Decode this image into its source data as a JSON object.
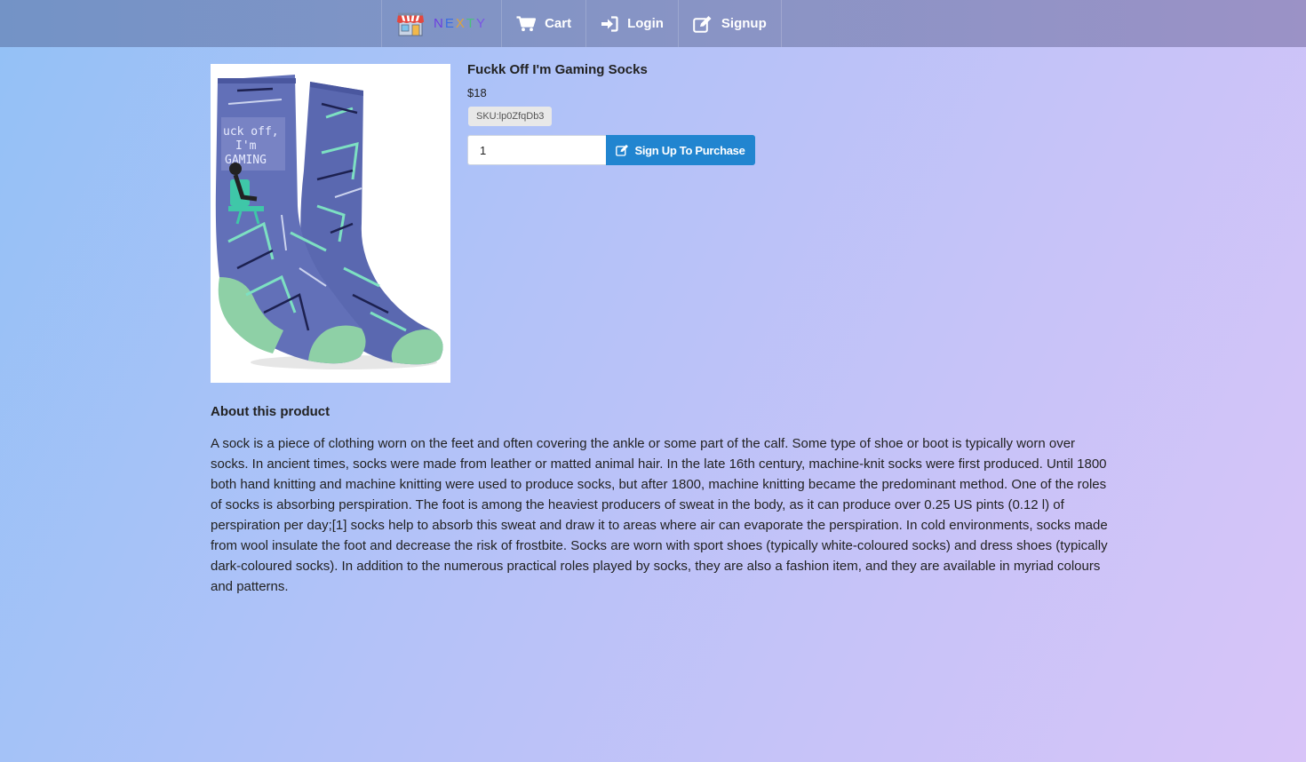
{
  "nav": {
    "brand_letters": [
      "N",
      "E",
      "X",
      "T",
      "Y"
    ],
    "cart_label": "Cart",
    "login_label": "Login",
    "signup_label": "Signup"
  },
  "product": {
    "title": "Fuckk Off I'm Gaming Socks",
    "price": "$18",
    "sku": "SKU:lp0ZfqDb3",
    "quantity": "1",
    "purchase_label": "Sign Up To Purchase",
    "image_lettering": "Fuck off, I'm GAMING"
  },
  "about": {
    "heading": "About this product",
    "text": "A sock is a piece of clothing worn on the feet and often covering the ankle or some part of the calf. Some type of shoe or boot is typically worn over socks. In ancient times, socks were made from leather or matted animal hair. In the late 16th century, machine-knit socks were first produced. Until 1800 both hand knitting and machine knitting were used to produce socks, but after 1800, machine knitting became the predominant method. One of the roles of socks is absorbing perspiration. The foot is among the heaviest producers of sweat in the body, as it can produce over 0.25 US pints (0.12 l) of perspiration per day;[1] socks help to absorb this sweat and draw it to areas where air can evaporate the perspiration. In cold environments, socks made from wool insulate the foot and decrease the risk of frostbite. Socks are worn with sport shoes (typically white-coloured socks) and dress shoes (typically dark-coloured socks). In addition to the numerous practical roles played by socks, they are also a fashion item, and they are available in myriad colours and patterns."
  },
  "colors": {
    "accent_button": "#2185d0",
    "topbar_start": "#7393c6",
    "topbar_end": "#9b92c6"
  },
  "icons": {
    "brand": "store-icon",
    "cart": "cart-icon",
    "login": "sign-in-icon",
    "signup": "edit-icon",
    "purchase": "edit-icon"
  }
}
